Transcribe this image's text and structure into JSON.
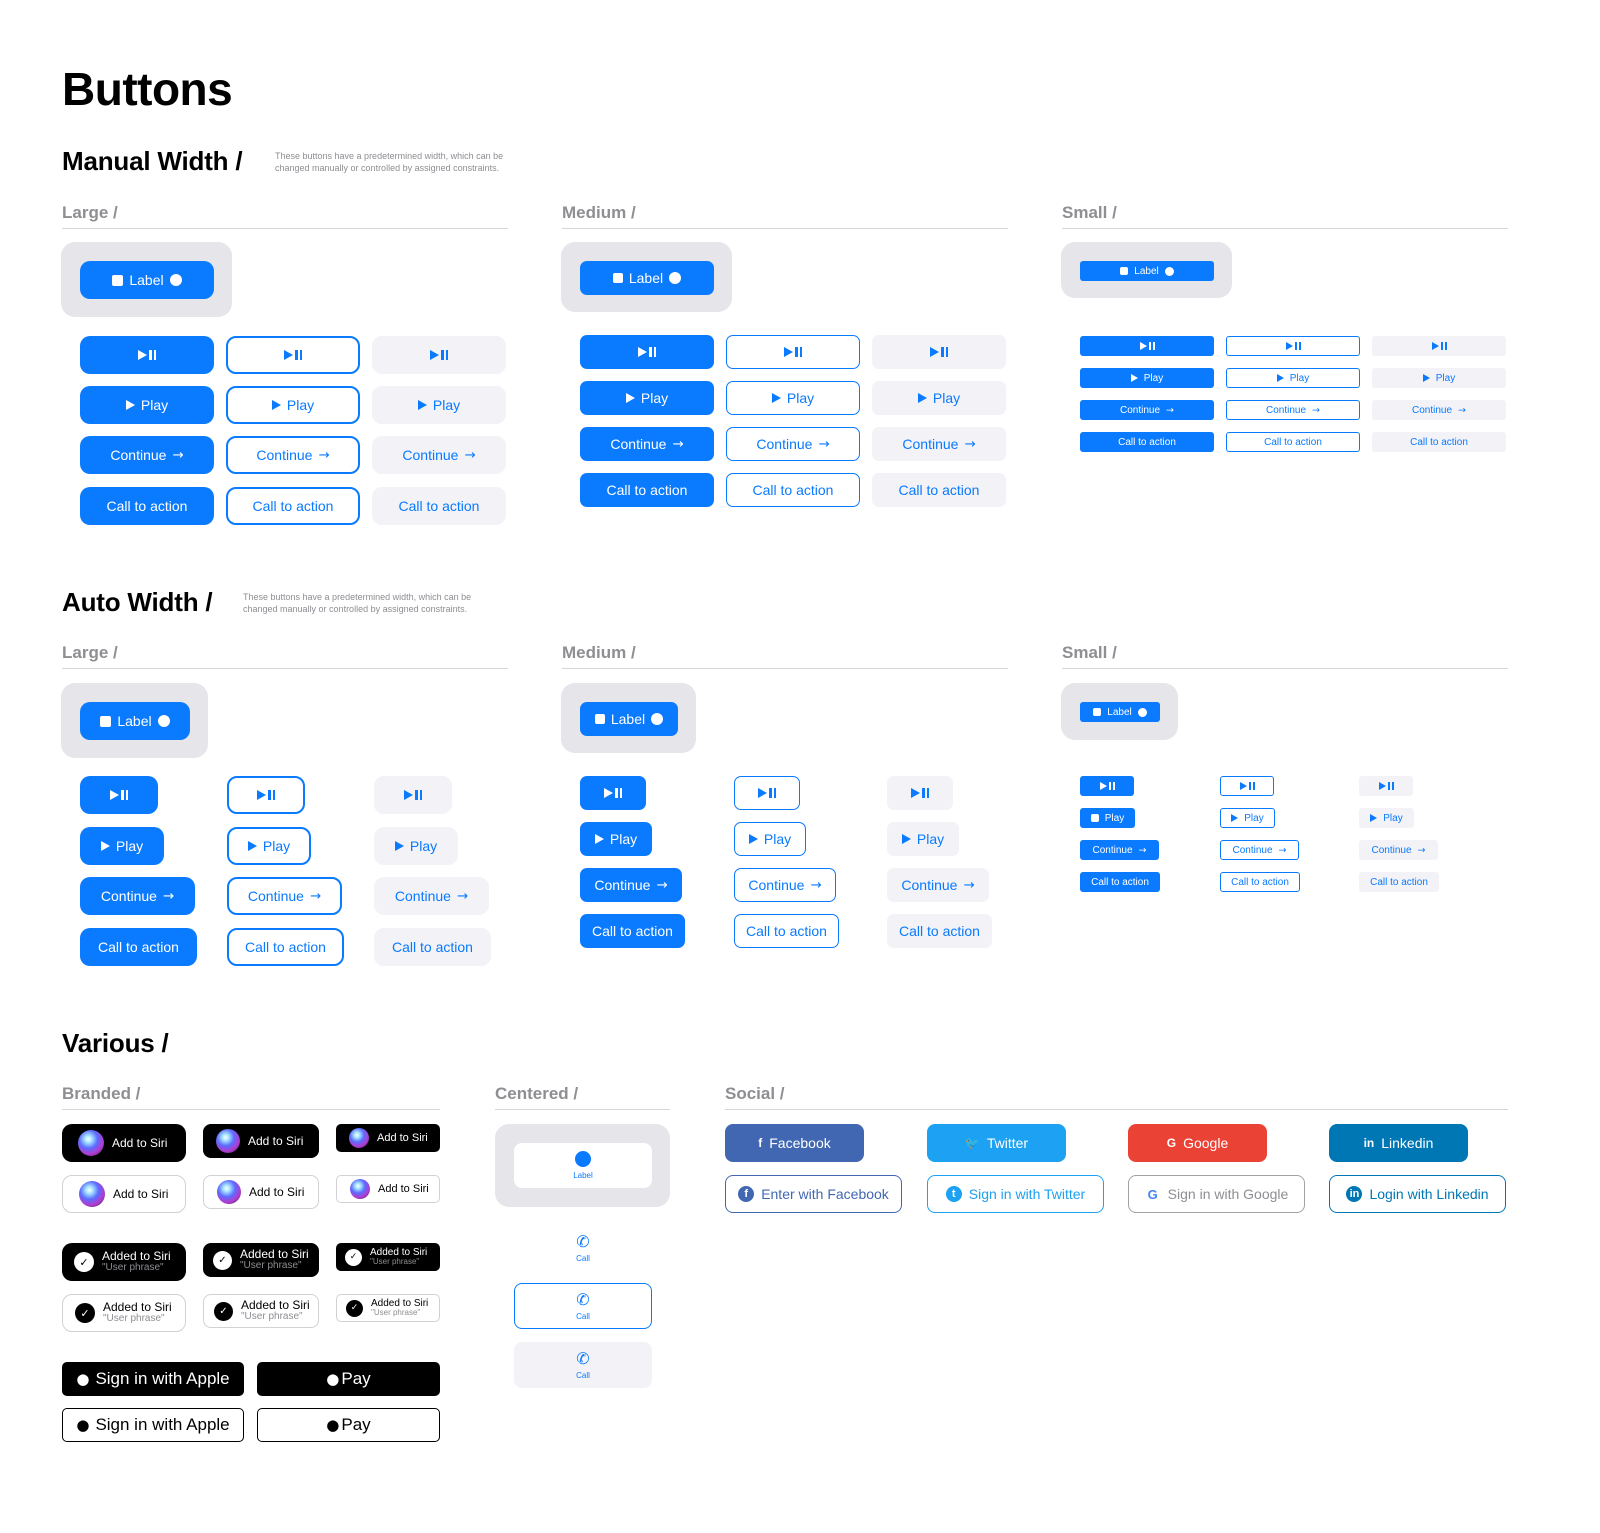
{
  "page_title": "Buttons",
  "colors": {
    "accent": "#0a7aff",
    "tint_bg": "#f2f2f7",
    "tray_bg": "#e5e5ea",
    "muted_text": "#8e8e93",
    "facebook": "#4267b2",
    "twitter": "#1da1f2",
    "google": "#ea4335",
    "linkedin": "#0077b5"
  },
  "sections": {
    "manual": {
      "title": "Manual Width /",
      "description": "These buttons have a predetermined width, which can be changed manually or controlled by assigned constraints."
    },
    "auto": {
      "title": "Auto Width /",
      "description": "These buttons have a predetermined width, which can be changed manually or controlled by assigned constraints."
    },
    "various": {
      "title": "Various /"
    }
  },
  "groups": {
    "large": "Large /",
    "medium": "Medium /",
    "small": "Small /",
    "branded": "Branded /",
    "centered": "Centered /",
    "social": "Social /"
  },
  "buttons": {
    "label": "Label",
    "play": "Play",
    "continue": "Continue",
    "cta": "Call to action",
    "arrow": "→",
    "play_pause_icon": "play-pause-icon"
  },
  "variants": [
    "Primary",
    "Outline",
    "Tinted"
  ],
  "branded": {
    "add_to_siri": "Add to Siri",
    "added_to_siri": "Added to Siri",
    "user_phrase": "\"User phrase\"",
    "sign_in_apple": "Sign in with Apple",
    "apple_pay": "Pay",
    "apple_glyph": ""
  },
  "centered": {
    "label": "Label",
    "call": "Call",
    "phone_glyph": "✆"
  },
  "social": {
    "filled": [
      {
        "name": "facebook",
        "label": "Facebook",
        "icon": "f"
      },
      {
        "name": "twitter",
        "label": "Twitter",
        "icon": "🐦"
      },
      {
        "name": "google",
        "label": "Google",
        "icon": "G"
      },
      {
        "name": "linkedin",
        "label": "Linkedin",
        "icon": "in"
      }
    ],
    "outlined": [
      {
        "name": "facebook",
        "label": "Enter with Facebook",
        "icon": "f"
      },
      {
        "name": "twitter",
        "label": "Sign in with Twitter",
        "icon": "t"
      },
      {
        "name": "google",
        "label": "Sign in with Google",
        "icon": "G"
      },
      {
        "name": "linkedin",
        "label": "Login with Linkedin",
        "icon": "in"
      }
    ]
  }
}
